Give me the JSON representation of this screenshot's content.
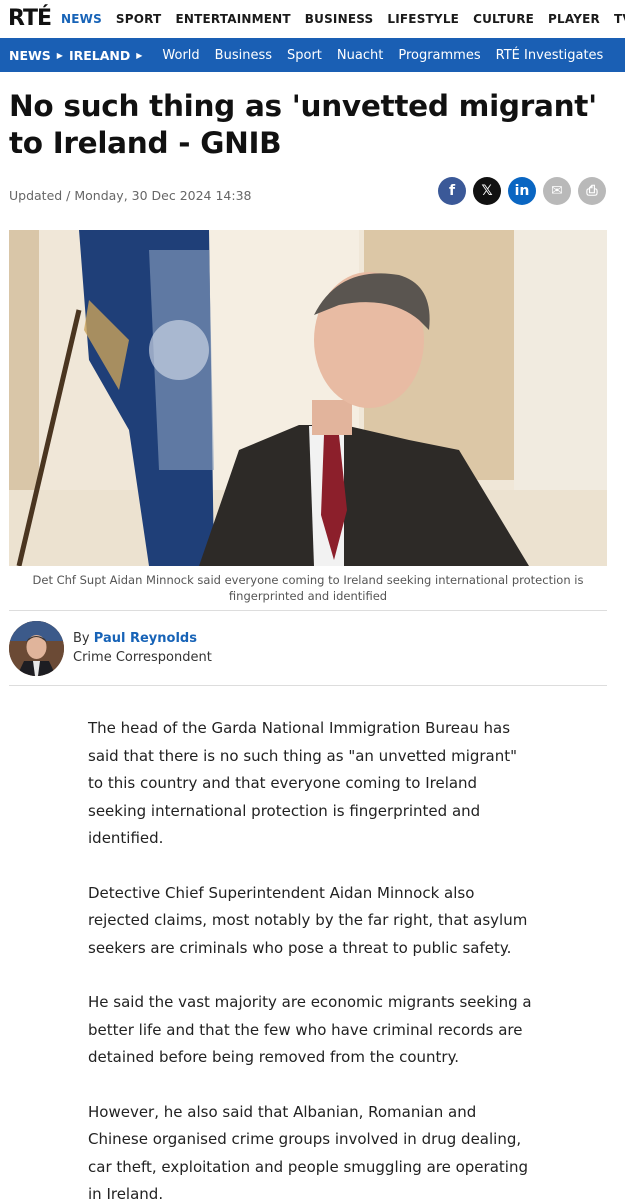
{
  "site": {
    "logo": "RTÉ",
    "top_nav": [
      "NEWS",
      "SPORT",
      "ENTERTAINMENT",
      "BUSINESS",
      "LIFESTYLE",
      "CULTURE",
      "PLAYER",
      "TV"
    ],
    "active_top": "NEWS"
  },
  "subnav": {
    "crumbs": [
      "NEWS",
      "IRELAND"
    ],
    "links": [
      "World",
      "Business",
      "Sport",
      "Nuacht",
      "Programmes",
      "RTÉ Investigates"
    ]
  },
  "article": {
    "headline": "No such thing as 'unvetted migrant' to Ireland - GNIB",
    "updated": "Updated / Monday, 30 Dec 2024 14:38",
    "caption": "Det Chf Supt Aidan Minnock said everyone coming to Ireland seeking international protection is fingerprinted and identified",
    "author": {
      "by": "By",
      "name": "Paul Reynolds",
      "role": "Crime Correspondent"
    },
    "paragraphs": [
      "The head of the Garda National Immigration Bureau has said that there is no such thing as \"an unvetted migrant\" to this country and that everyone coming to Ireland seeking international protection is fingerprinted and identified.",
      "Detective Chief Superintendent Aidan Minnock also rejected claims, most notably by the far right, that asylum seekers are criminals who pose a threat to public safety.",
      "He said the vast majority are economic migrants seeking a better life and that the few who have criminal records are detained before being removed from the country.",
      "However, he also said that Albanian, Romanian and Chinese organised crime groups involved in drug dealing, car theft, exploitation and people smuggling are operating in Ireland."
    ]
  },
  "share": {
    "icons": [
      "facebook-icon",
      "x-icon",
      "linkedin-icon",
      "email-icon",
      "print-icon"
    ],
    "glyphs": {
      "facebook": "f",
      "x": "𝕏",
      "linkedin": "in",
      "email": "✉",
      "print": "⎙"
    }
  },
  "colors": {
    "accent": "#1763b7",
    "subnav_bg": "#1a5fb4"
  }
}
